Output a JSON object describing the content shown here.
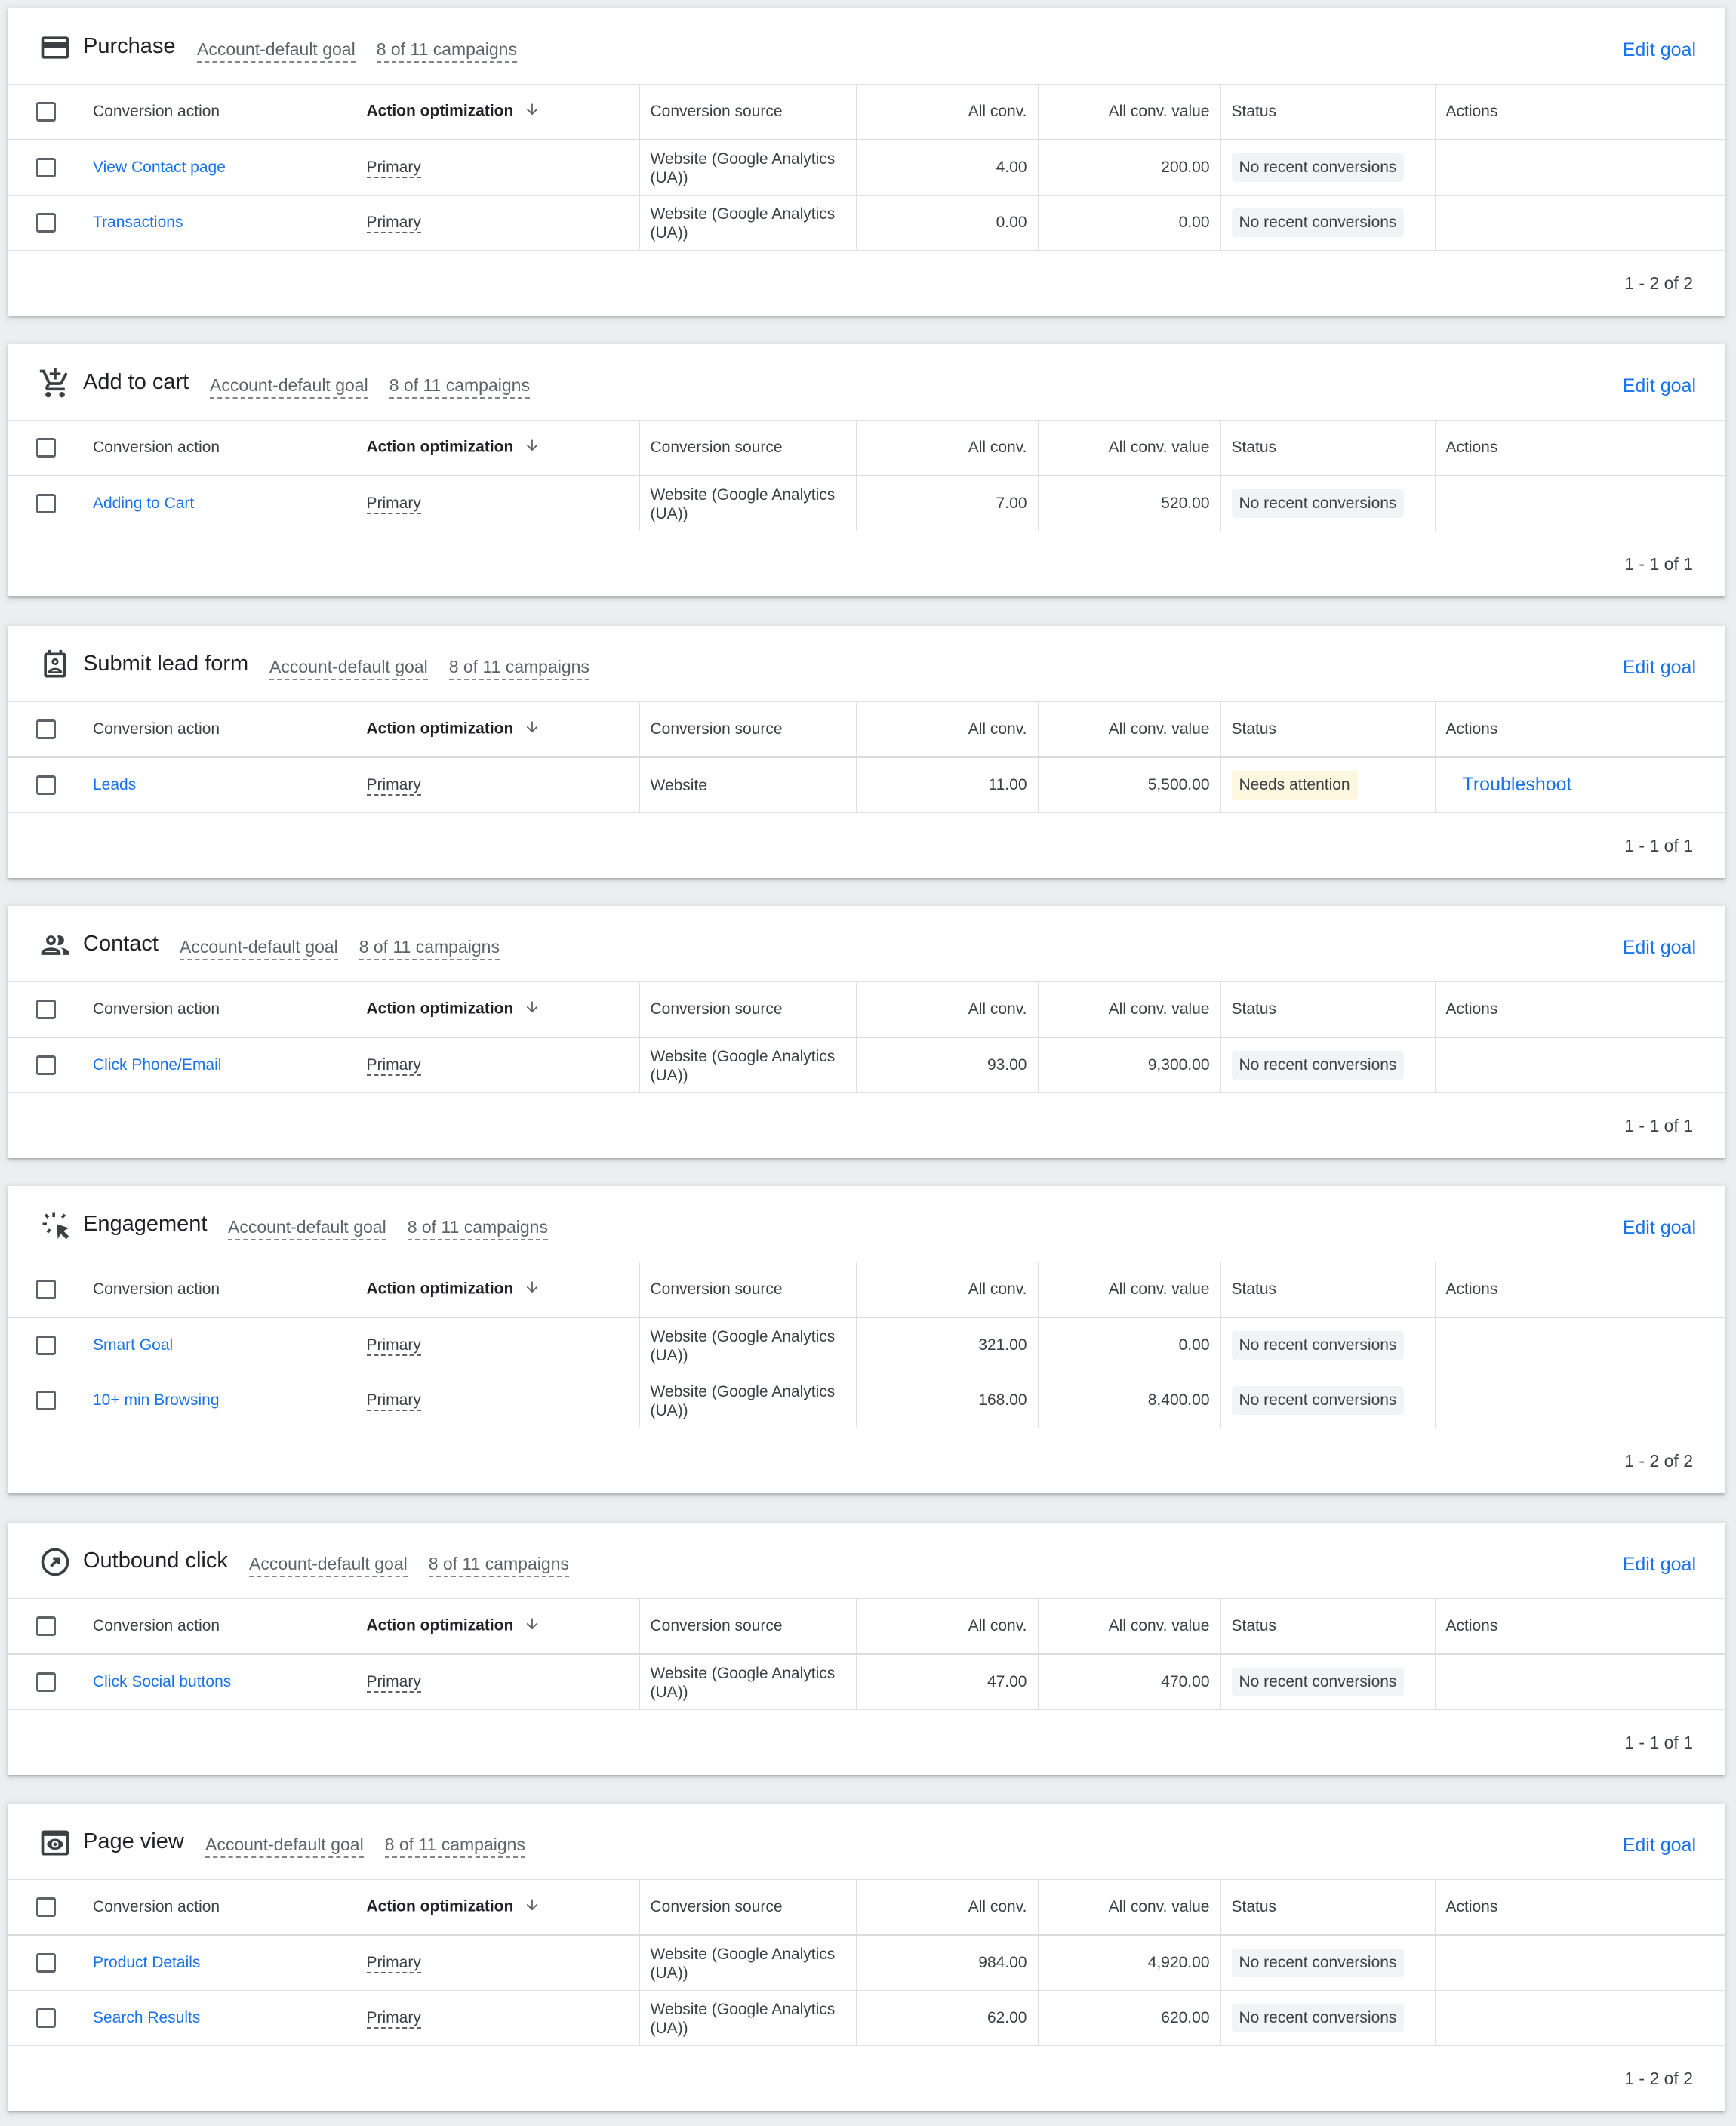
{
  "headers": {
    "conversion_action": "Conversion action",
    "action_optimization": "Action optimization",
    "conversion_source": "Conversion source",
    "all_conv": "All conv.",
    "all_conv_value": "All conv. value",
    "status": "Status",
    "actions": "Actions"
  },
  "goals": [
    {
      "title": "Purchase",
      "icon": "credit-card-icon",
      "default_label": "Account-default goal",
      "campaigns": "8 of 11 campaigns",
      "edit_label": "Edit goal",
      "rows": [
        {
          "action": "View Contact page",
          "optimization": "Primary",
          "source": "Website (Google Analytics (UA))",
          "all_conv": "4.00",
          "all_conv_value": "200.00",
          "status": "No recent conversions",
          "actions": ""
        },
        {
          "action": "Transactions",
          "optimization": "Primary",
          "source": "Website (Google Analytics (UA))",
          "all_conv": "0.00",
          "all_conv_value": "0.00",
          "status": "No recent conversions",
          "actions": ""
        }
      ],
      "pager": "1 - 2 of 2"
    },
    {
      "title": "Add to cart",
      "icon": "add-shopping-cart-icon",
      "default_label": "Account-default goal",
      "campaigns": "8 of 11 campaigns",
      "edit_label": "Edit goal",
      "rows": [
        {
          "action": "Adding to Cart",
          "optimization": "Primary",
          "source": "Website (Google Analytics (UA))",
          "all_conv": "7.00",
          "all_conv_value": "520.00",
          "status": "No recent conversions",
          "actions": ""
        }
      ],
      "pager": "1 - 1 of 1"
    },
    {
      "title": "Submit lead form",
      "icon": "contact-form-icon",
      "default_label": "Account-default goal",
      "campaigns": "8 of 11 campaigns",
      "edit_label": "Edit goal",
      "rows": [
        {
          "action": "Leads",
          "optimization": "Primary",
          "source": "Website",
          "all_conv": "11.00",
          "all_conv_value": "5,500.00",
          "status": "Needs attention",
          "actions": "Troubleshoot"
        }
      ],
      "pager": "1 - 1 of 1"
    },
    {
      "title": "Contact",
      "icon": "people-icon",
      "default_label": "Account-default goal",
      "campaigns": "8 of 11 campaigns",
      "edit_label": "Edit goal",
      "rows": [
        {
          "action": "Click Phone/Email",
          "optimization": "Primary",
          "source": "Website (Google Analytics (UA))",
          "all_conv": "93.00",
          "all_conv_value": "9,300.00",
          "status": "No recent conversions",
          "actions": ""
        }
      ],
      "pager": "1 - 1 of 1"
    },
    {
      "title": "Engagement",
      "icon": "cursor-click-icon",
      "default_label": "Account-default goal",
      "campaigns": "8 of 11 campaigns",
      "edit_label": "Edit goal",
      "rows": [
        {
          "action": "Smart Goal",
          "optimization": "Primary",
          "source": "Website (Google Analytics (UA))",
          "all_conv": "321.00",
          "all_conv_value": "0.00",
          "status": "No recent conversions",
          "actions": ""
        },
        {
          "action": "10+ min Browsing",
          "optimization": "Primary",
          "source": "Website (Google Analytics (UA))",
          "all_conv": "168.00",
          "all_conv_value": "8,400.00",
          "status": "No recent conversions",
          "actions": ""
        }
      ],
      "pager": "1 - 2 of 2"
    },
    {
      "title": "Outbound click",
      "icon": "outbound-arrow-icon",
      "default_label": "Account-default goal",
      "campaigns": "8 of 11 campaigns",
      "edit_label": "Edit goal",
      "rows": [
        {
          "action": "Click Social buttons",
          "optimization": "Primary",
          "source": "Website (Google Analytics (UA))",
          "all_conv": "47.00",
          "all_conv_value": "470.00",
          "status": "No recent conversions",
          "actions": ""
        }
      ],
      "pager": "1 - 1 of 1"
    },
    {
      "title": "Page view",
      "icon": "page-view-eye-icon",
      "default_label": "Account-default goal",
      "campaigns": "8 of 11 campaigns",
      "edit_label": "Edit goal",
      "rows": [
        {
          "action": "Product Details",
          "optimization": "Primary",
          "source": "Website (Google Analytics (UA))",
          "all_conv": "984.00",
          "all_conv_value": "4,920.00",
          "status": "No recent conversions",
          "actions": ""
        },
        {
          "action": "Search Results",
          "optimization": "Primary",
          "source": "Website (Google Analytics (UA))",
          "all_conv": "62.00",
          "all_conv_value": "620.00",
          "status": "No recent conversions",
          "actions": ""
        }
      ],
      "pager": "1 - 2 of 2"
    }
  ],
  "colors": {
    "link": "#1a73e8",
    "warning_chip": "#fef7e0",
    "neutral_chip": "#f1f3f4",
    "background": "#eceff1"
  }
}
